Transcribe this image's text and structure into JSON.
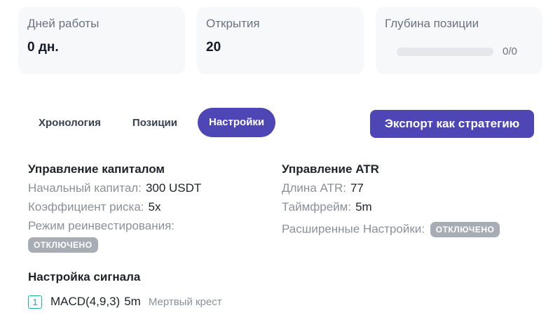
{
  "stats": {
    "days": {
      "label": "Дней работы",
      "value": "0 дн."
    },
    "opens": {
      "label": "Открытия",
      "value": "20"
    },
    "depth": {
      "label": "Глубина позиции",
      "text": "0/0",
      "fill_fraction": 0
    }
  },
  "tabs": [
    {
      "label": "Хронология",
      "active": false
    },
    {
      "label": "Позиции",
      "active": false
    },
    {
      "label": "Настройки",
      "active": true
    }
  ],
  "export_button": {
    "label": "Экспорт как стратегию"
  },
  "capital": {
    "title": "Управление капиталом",
    "initial": {
      "label": "Начальный капитал:",
      "value": "300 USDT"
    },
    "risk": {
      "label": "Коэффициент риска:",
      "value": "5x"
    },
    "reinvest": {
      "label": "Режим реинвестирования:",
      "badge": "ОТКЛЮЧЕНО"
    }
  },
  "atr": {
    "title": "Управление ATR",
    "length": {
      "label": "Длина ATR:",
      "value": "77"
    },
    "timeframe": {
      "label": "Таймфрейм:",
      "value": "5m"
    },
    "advanced": {
      "label": "Расширенные Настройки:",
      "badge": "ОТКЛЮЧЕНО"
    }
  },
  "signal": {
    "title": "Настройка сигнала",
    "items": [
      {
        "num": "1",
        "name": "MACD(4,9,3)",
        "timeframe": "5m",
        "condition": "Мертвый крест"
      }
    ]
  },
  "colors": {
    "accent": "#4e46b4",
    "badge": "#a8adb5",
    "signal_num": "#19b3a6"
  }
}
